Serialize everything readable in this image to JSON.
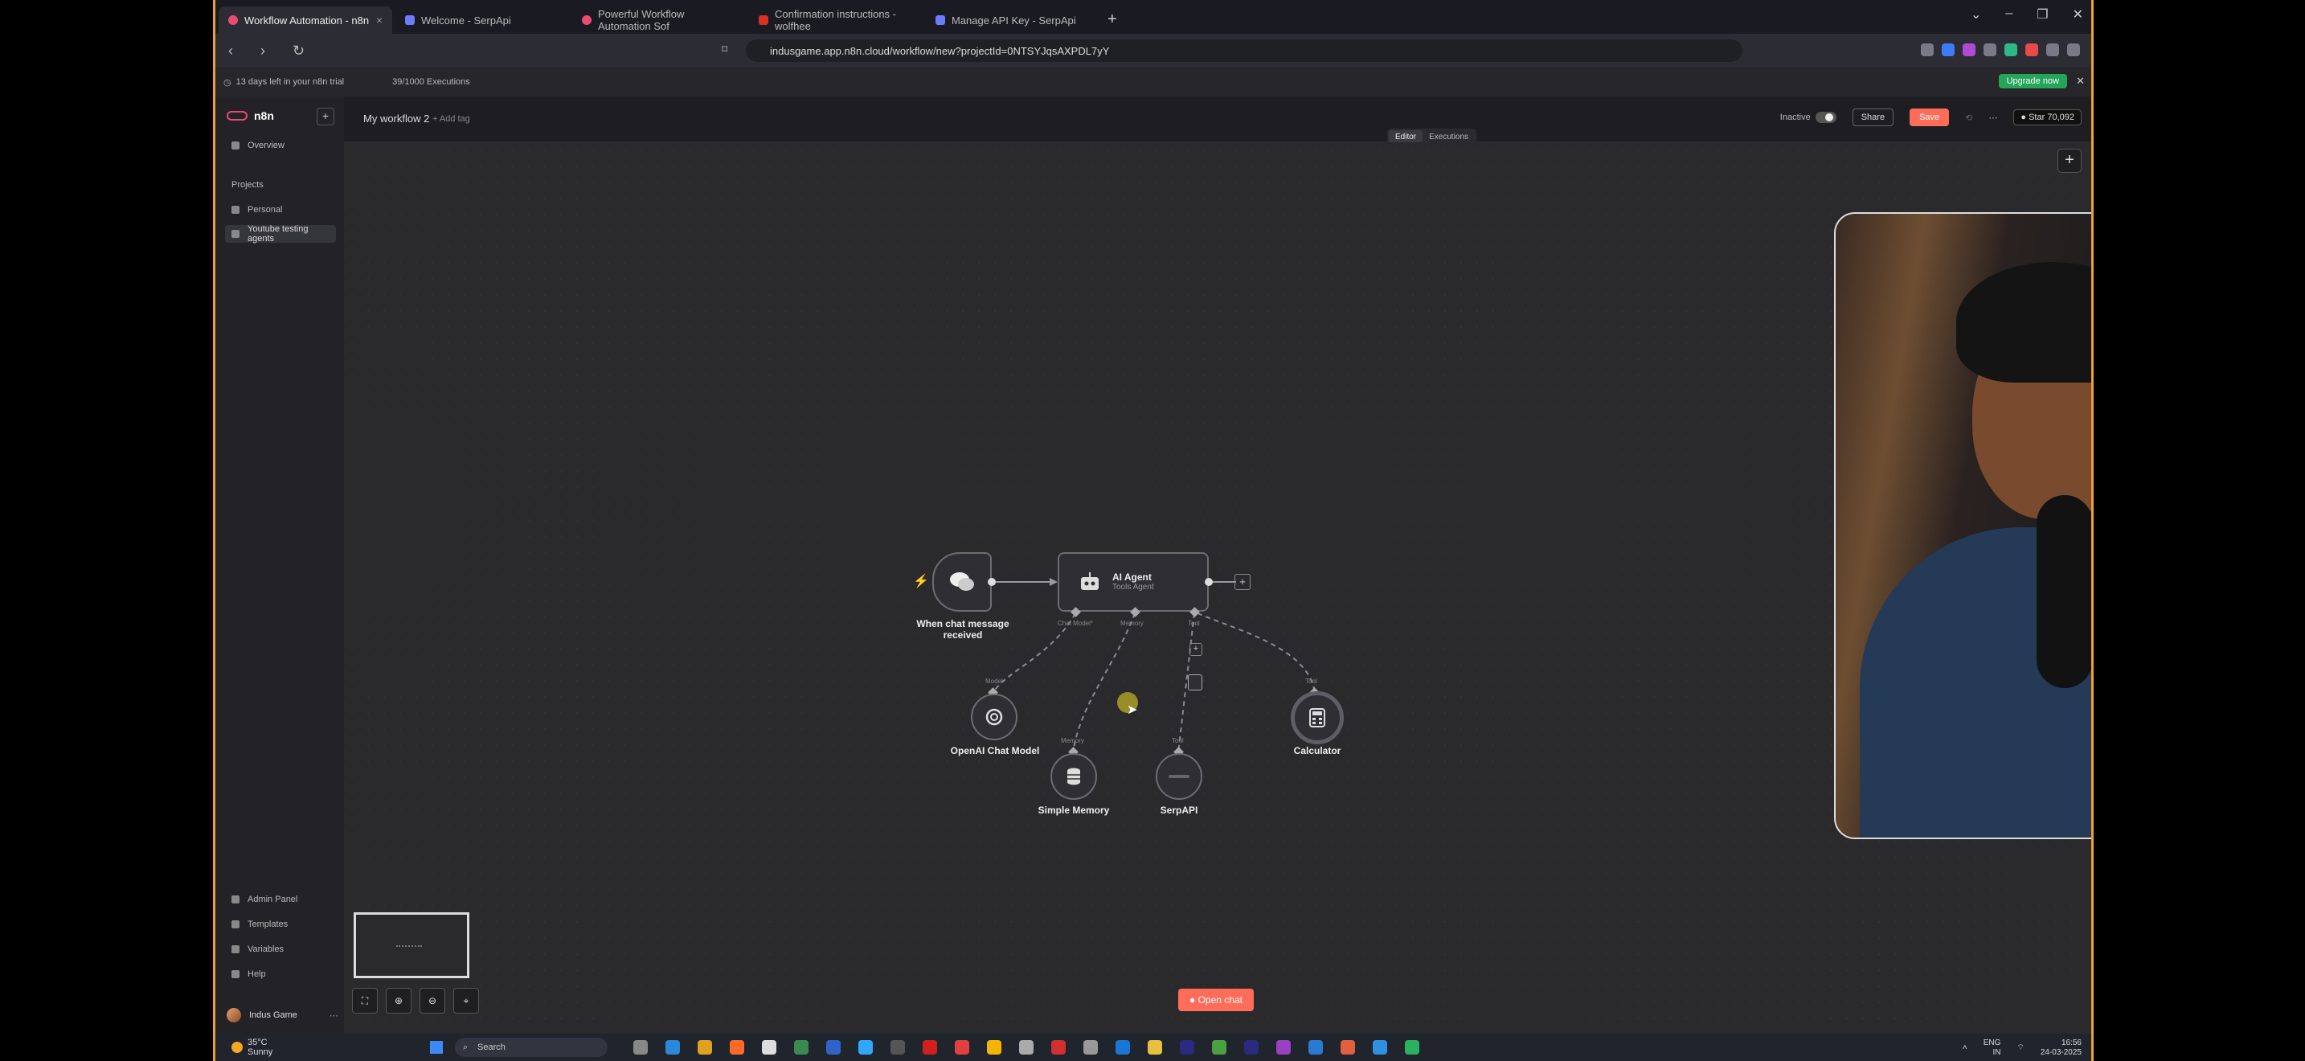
{
  "browser": {
    "tabs": [
      {
        "label": "Workflow Automation - n8n",
        "active": true
      },
      {
        "label": "Welcome - SerpApi",
        "active": false
      },
      {
        "label": "Powerful Workflow Automation Sof",
        "active": false
      },
      {
        "label": "Confirmation instructions - wolfhee",
        "active": false
      },
      {
        "label": "Manage API Key - SerpApi",
        "active": false
      }
    ],
    "url": "indusgame.app.n8n.cloud/workflow/new?projectId=0NTSYJqsAXPDL7yY"
  },
  "banner": {
    "trial_text": "13 days left in your n8n trial",
    "executions": "39/1000 Executions",
    "upgrade_label": "Upgrade now"
  },
  "sidebar": {
    "logo": "n8n",
    "overview": "Overview",
    "projects_heading": "Projects",
    "projects": [
      "Personal",
      "Youtube testing agents"
    ],
    "bottom": [
      "Admin Panel",
      "Templates",
      "Variables",
      "Help"
    ],
    "user": "Indus Game"
  },
  "header": {
    "workflow_title": "My workflow 2",
    "add_tag": "+ Add tag",
    "status": "Inactive",
    "share": "Share",
    "save": "Save",
    "github_star": "Star",
    "github_count": "70,092",
    "tabs": [
      "Editor",
      "Executions"
    ]
  },
  "workflow": {
    "trigger": {
      "label": "When chat message received"
    },
    "agent": {
      "title": "AI Agent",
      "subtitle": "Tools Agent",
      "ports": [
        "Chat Model*",
        "Memory",
        "Tool"
      ]
    },
    "subnodes": [
      {
        "label": "OpenAI Chat Model",
        "port": "Model"
      },
      {
        "label": "Simple Memory",
        "port": "Memory"
      },
      {
        "label": "SerpAPI",
        "port": "Tool"
      },
      {
        "label": "Calculator",
        "port": "Tool"
      }
    ]
  },
  "open_chat": "Open chat",
  "taskbar": {
    "temp": "35°C",
    "weather": "Sunny",
    "search": "Search",
    "lang": "ENG",
    "region": "IN",
    "time": "16:56",
    "date": "24-03-2025"
  },
  "colors": {
    "accent": "#ff6d5a",
    "upgrade": "#23a55a",
    "brand": "#ea4b71"
  }
}
